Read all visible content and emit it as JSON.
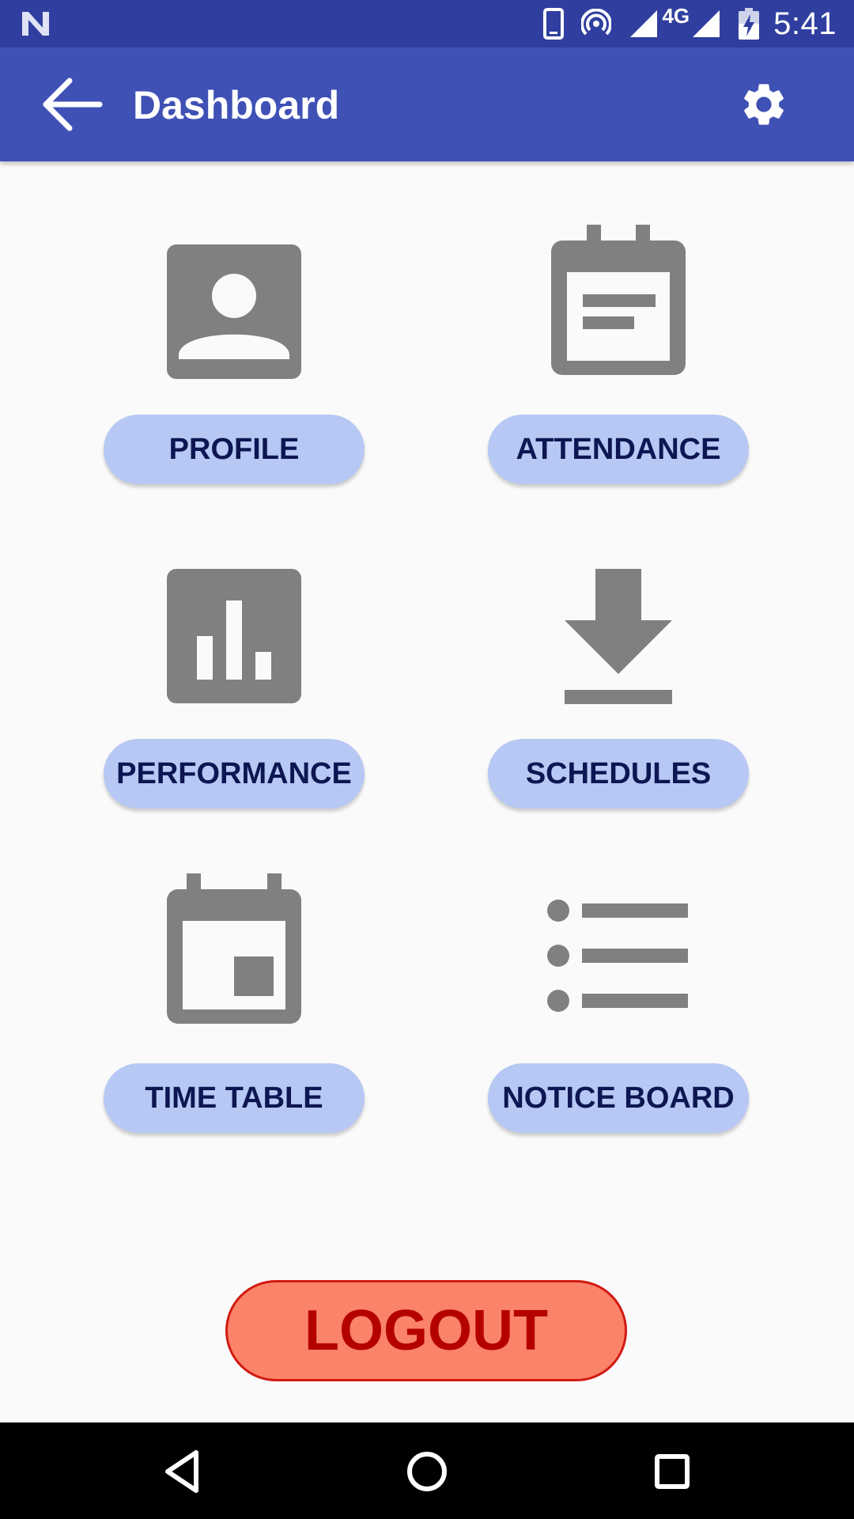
{
  "status_bar": {
    "time": "5:41",
    "network": "4G",
    "icons": [
      "notification-n-icon",
      "phone-icon",
      "hotspot-icon",
      "signal-icon",
      "signal-icon-2",
      "battery-charging-icon"
    ]
  },
  "app_bar": {
    "title": "Dashboard",
    "back_icon": "arrow-back-icon",
    "settings_icon": "gear-icon",
    "color": "#3f51b5"
  },
  "tiles": [
    {
      "label": "PROFILE",
      "icon": "profile-icon"
    },
    {
      "label": "ATTENDANCE",
      "icon": "calendar-event-icon"
    },
    {
      "label": "PERFORMANCE",
      "icon": "bar-chart-icon"
    },
    {
      "label": "SCHEDULES",
      "icon": "download-icon"
    },
    {
      "label": "TIME TABLE",
      "icon": "calendar-today-icon"
    },
    {
      "label": "NOTICE BOARD",
      "icon": "list-icon"
    }
  ],
  "logout": {
    "label": "LOGOUT",
    "color": "#fa8369"
  },
  "nav": {
    "icons": [
      "back-triangle-icon",
      "home-circle-icon",
      "recents-square-icon"
    ]
  }
}
